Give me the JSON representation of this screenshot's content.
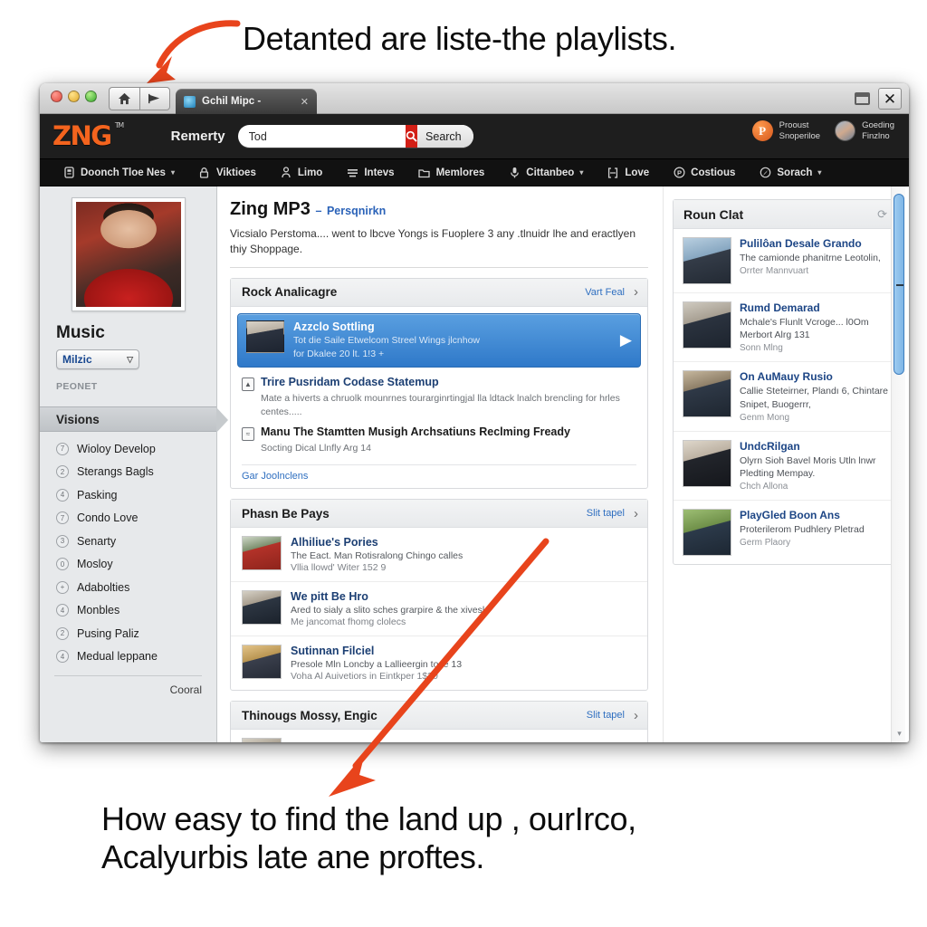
{
  "annotations": {
    "top": "Detanted are liste-the playlists.",
    "bottom_line1": "How easy to find the land up , ourIrco,",
    "bottom_line2": "Acalyurbis late ane proftes."
  },
  "window": {
    "tab_title": "Gchil Mipc -",
    "tab_close": "✕",
    "back_icon": "home-icon",
    "forward_icon": "flag-icon",
    "restore_label": "⬓",
    "close_label": "✕"
  },
  "header": {
    "logo": "ZNG",
    "logo_tm": "TM",
    "word": "Remerty",
    "search_value": "Tod",
    "search_placeholder": "Tod",
    "search_button": "Search",
    "accounts": [
      {
        "avatar": "p-badge-icon",
        "line1": "Prooust",
        "line2": "Snoperiloe"
      },
      {
        "avatar": "user-photo-icon",
        "line1": "Goeding",
        "line2": "Finzlno"
      }
    ]
  },
  "nav": [
    {
      "icon": "book-icon",
      "label": "Doonch Tloe Nes",
      "caret": "▾"
    },
    {
      "icon": "lock-icon",
      "label": "Viktioes",
      "caret": ""
    },
    {
      "icon": "person-icon",
      "label": "Limo",
      "caret": ""
    },
    {
      "icon": "list-icon",
      "label": "Intevs",
      "caret": ""
    },
    {
      "icon": "folder-icon",
      "label": "Memlores",
      "caret": ""
    },
    {
      "icon": "mic-icon",
      "label": "Cittanbeo",
      "caret": "▾"
    },
    {
      "icon": "bracket-icon",
      "label": "Love",
      "caret": ""
    },
    {
      "icon": "circle-p-icon",
      "label": "Costious",
      "caret": ""
    },
    {
      "icon": "compass-icon",
      "label": "Sorach",
      "caret": "▾"
    }
  ],
  "sidebar": {
    "avatar_alt": "profile-photo",
    "title": "Music",
    "select_value": "Milzic",
    "select_caret": "▽",
    "subtitle": "PEONET",
    "section_header": "Visions",
    "items": [
      {
        "num": "7",
        "label": "Wioloy Develop"
      },
      {
        "num": "2",
        "label": "Sterangs Bagls"
      },
      {
        "num": "4",
        "label": "Pasking"
      },
      {
        "num": "7",
        "label": "Condo Love"
      },
      {
        "num": "3",
        "label": "Senarty"
      },
      {
        "num": "0",
        "label": "Mosloy"
      },
      {
        "num": "+",
        "label": "Adabolties"
      },
      {
        "num": "4",
        "label": "Monbles"
      },
      {
        "num": "2",
        "label": "Pusing Paliz"
      },
      {
        "num": "4",
        "label": "Medual leppane"
      }
    ],
    "footer": "Cooral"
  },
  "main": {
    "title": "Zing MP3",
    "title_dash": "–",
    "title_sub": "Persqnirkn",
    "description": "Vicsialo Perstoma.... went to lbcve Yongs is Fuoplere 3 any .tlnuidr lhe and eractlyen thiy Shoppage.",
    "sections": [
      {
        "heading": "Rock Analicagre",
        "more": "Vart Feal",
        "chevron": "›",
        "highlight": {
          "title": "Azzclo Sottling",
          "line1": "Tot die Saile Etwelcom Streel Wings jlcnhow",
          "line2": "for Dkalee 20 lt. 1!3 +",
          "play_icon": "play-icon"
        },
        "minis": [
          {
            "icon": "upload-icon",
            "title": "Trire Pusridam Codase Statemup",
            "desc": "Mate a hiverts a chruolk mounrnes tourarginrtingjal lla ldtack lnalch brencling for hrles centes....."
          },
          {
            "icon": "note-icon",
            "title": "Manu The Stamtten Musigh Archsatiuns Reclming Fready",
            "desc": "Socting Dical Llnfly Arg 14"
          }
        ],
        "card_link": "Gar Joolnclens"
      },
      {
        "heading": "Phasn Be Pays",
        "more": "Slit tapel",
        "chevron": "›",
        "rows": [
          {
            "title": "Alhiliue's Pories",
            "line1": "The Eact. Man Rotisralong Chingo calles",
            "line2": "Vllia llowd' Witer 152 9"
          },
          {
            "title": "We pitt Be Hro",
            "line1": "Ared to sialy a slito sches grarpire & the xivesl",
            "line2": "Me jancomat fhomg clolecs"
          },
          {
            "title": "Sutinnan Filciel",
            "line1": "Presole Mln Loncby a Lallieergin tose 13",
            "line2": "Voha Al Auivetiors in Eintkper 1$20"
          }
        ]
      },
      {
        "heading": "Thinougs Mossy, Engic",
        "more": "Slit tapel",
        "chevron": "›",
        "rows": []
      }
    ]
  },
  "rail": {
    "heading": "Roun Clat",
    "refresh_icon": "refresh-icon",
    "rows": [
      {
        "title": "Pulilôan Desale Grando",
        "line1": "The camionde phanitrne Leotolin,",
        "line2": "Orrter Mannvuart"
      },
      {
        "title": "Rumd Demarad",
        "line1": "Mchale's Flunlt Vcroge... l0Om Merbort Alrg 131",
        "line2": "Sonn Mlng"
      },
      {
        "title": "On AuMauy Rusio",
        "line1": "Callie Steteirner, Plandı 6, Chintare Snipet, Buogerrr,",
        "line2": "Genm Mong"
      },
      {
        "title": "UndcRilgan",
        "line1": "Olyrn Sioh Bavel Moris Utln lnwr Pledting Mempay.",
        "line2": "Chch Allona"
      },
      {
        "title": "PlayGled Boon Ans",
        "line1": "Proterilerom Pudhlery Pletrad",
        "line2": "Germ Plaory"
      }
    ]
  },
  "colors": {
    "accent_orange": "#f4641e",
    "accent_blue": "#2f79c9",
    "arrow_red": "#e8441c",
    "header_dark": "#1e1e1e",
    "nav_dark": "#111111"
  }
}
